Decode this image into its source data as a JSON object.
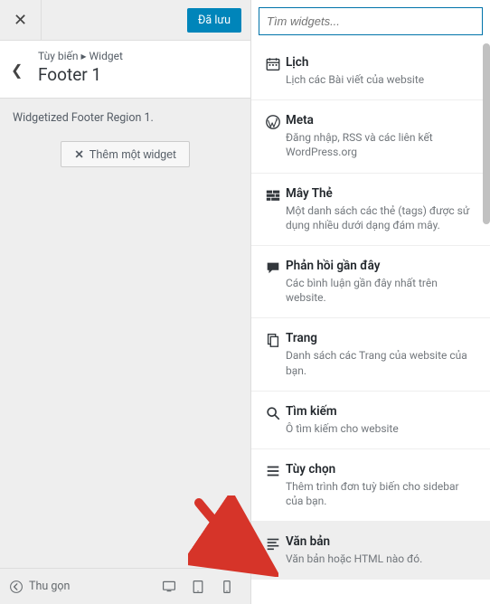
{
  "topbar": {
    "saved_label": "Đã lưu"
  },
  "breadcrumb": {
    "root": "Tùy biến",
    "sep": "▸",
    "leaf": "Widget"
  },
  "section": {
    "title": "Footer 1",
    "description": "Widgetized Footer Region 1."
  },
  "add_button": {
    "label": "Thêm một widget"
  },
  "footer": {
    "collapse": "Thu gọn"
  },
  "search": {
    "placeholder": "Tìm widgets..."
  },
  "widgets": [
    {
      "icon": "calendar",
      "title": "Lịch",
      "desc": "Lịch các Bài viết của website"
    },
    {
      "icon": "wordpress",
      "title": "Meta",
      "desc": "Đăng nhập, RSS và các liên kết WordPress.org"
    },
    {
      "icon": "bricks",
      "title": "Mây Thẻ",
      "desc": "Một danh sách các thẻ (tags) được sử dụng nhiều dưới dạng đám mây."
    },
    {
      "icon": "chat",
      "title": "Phản hồi gần đây",
      "desc": "Các bình luận gần đây nhất trên website."
    },
    {
      "icon": "pages",
      "title": "Trang",
      "desc": "Danh sách các Trang của website của bạn."
    },
    {
      "icon": "search",
      "title": "Tìm kiếm",
      "desc": "Ô tìm kiếm cho website"
    },
    {
      "icon": "menu",
      "title": "Tùy chọn",
      "desc": "Thêm trình đơn tuỳ biến cho sidebar của bạn."
    },
    {
      "icon": "text",
      "title": "Văn bản",
      "desc": "Văn bản hoặc HTML nào đó."
    }
  ]
}
